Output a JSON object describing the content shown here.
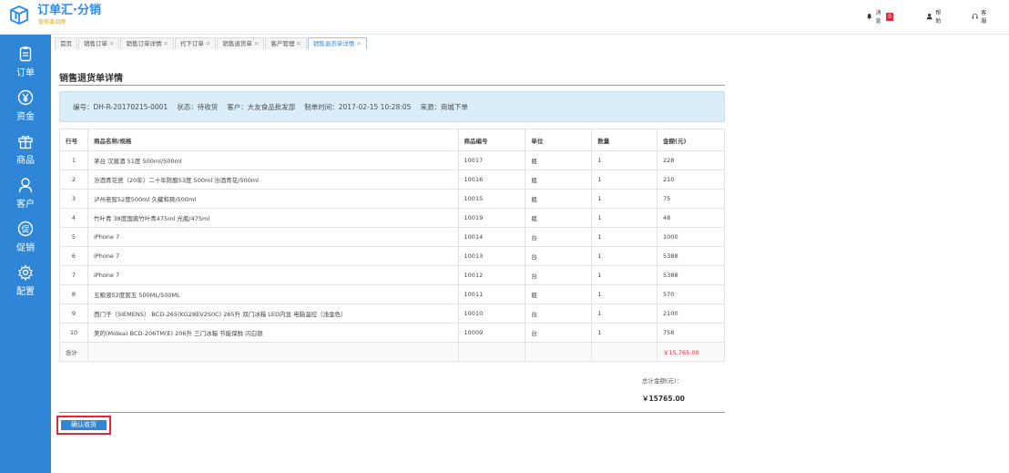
{
  "app": {
    "brand": "订单汇·分销",
    "brand_sub": "管家婆品牌",
    "accent": "#2f86d6"
  },
  "top_actions": {
    "messages_label": "消息",
    "messages_badge": "0",
    "help_label": "帮助",
    "service_label": "客服"
  },
  "sidebar": {
    "items": [
      {
        "label": "订单",
        "icon": "clipboard-icon"
      },
      {
        "label": "资金",
        "icon": "yen-icon"
      },
      {
        "label": "商品",
        "icon": "gift-icon"
      },
      {
        "label": "客户",
        "icon": "user-icon"
      },
      {
        "label": "促销",
        "icon": "promo-icon"
      },
      {
        "label": "配置",
        "icon": "gear-icon"
      }
    ]
  },
  "tabs": [
    {
      "label": "首页",
      "closable": false
    },
    {
      "label": "销售订单",
      "closable": true
    },
    {
      "label": "销售订单详情",
      "closable": true
    },
    {
      "label": "代下订单",
      "closable": true
    },
    {
      "label": "销售退货单",
      "closable": true
    },
    {
      "label": "客户管理",
      "closable": true
    },
    {
      "label": "销售退货单详情",
      "closable": true,
      "active": true
    }
  ],
  "page": {
    "title": "销售退货单详情"
  },
  "info": {
    "number": "编号：DH-R-20170215-0001",
    "status": "状态：待收货",
    "customer": "客户：大友食品批发部",
    "created": "制单时间：2017-02-15 10:28:05",
    "source": "来源：商城下单"
  },
  "table": {
    "headers": [
      "行号",
      "商品名称/规格",
      "商品编号",
      "单位",
      "数量",
      "金额(元)"
    ],
    "rows": [
      [
        "1",
        "茅台 汉酱酒 51度 500ml/500ml",
        "10017",
        "瓶",
        "1",
        "228"
      ],
      [
        "2",
        "汾酒青花瓷（20年）二十年陈酿53度 500ml 汾酒青花/500ml",
        "10016",
        "瓶",
        "1",
        "210"
      ],
      [
        "3",
        "泸州老窖52度500ml 久藏和爽/500ml",
        "10015",
        "瓶",
        "1",
        "75"
      ],
      [
        "4",
        "竹叶青 38度国酱竹叶青475ml 光瓶/475ml",
        "10019",
        "瓶",
        "1",
        "48"
      ],
      [
        "5",
        "iPhone 7",
        "10014",
        "台",
        "1",
        "1000"
      ],
      [
        "6",
        "iPhone 7",
        "10013",
        "台",
        "1",
        "5388"
      ],
      [
        "7",
        "iPhone 7",
        "10012",
        "台",
        "1",
        "5388"
      ],
      [
        "8",
        "五粮液52度窖五 500ML/500ML",
        "10011",
        "瓶",
        "1",
        "570"
      ],
      [
        "9",
        "西门子（SIEMENS） BCD-265(KG28EV2S0C) 265升 双门冰箱 LED内显 电脑温控（浅金色）",
        "10010",
        "台",
        "1",
        "2100"
      ],
      [
        "10",
        "美的(Midea) BCD-206TM(E) 206升 三门冰箱 节能保鲜 闪白银",
        "10009",
        "台",
        "1",
        "758"
      ]
    ],
    "sum_label": "合计",
    "sum_amount": "￥15,765.00"
  },
  "totals": {
    "label": "总计金额(元)：",
    "value": "￥15765.00"
  },
  "actions": {
    "confirm_label": "确认收货"
  }
}
